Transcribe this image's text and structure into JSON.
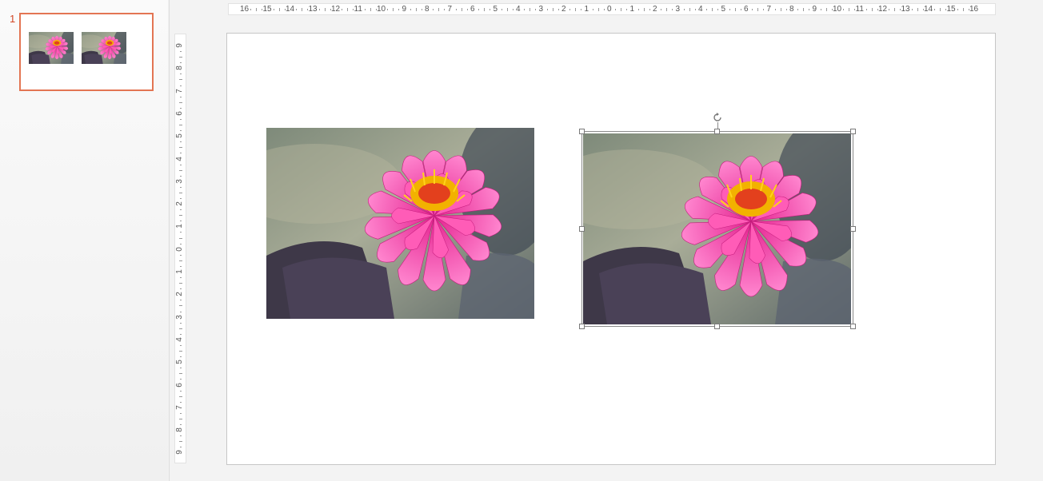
{
  "thumbnails": {
    "slide_number": "1"
  },
  "ruler": {
    "horizontal_labels": [
      "16",
      "15",
      "14",
      "13",
      "12",
      "11",
      "10",
      "9",
      "8",
      "7",
      "6",
      "5",
      "4",
      "3",
      "2",
      "1",
      "0",
      "1",
      "2",
      "3",
      "4",
      "5",
      "6",
      "7",
      "8",
      "9",
      "10",
      "11",
      "12",
      "13",
      "14",
      "15",
      "16"
    ],
    "vertical_labels": [
      "9",
      "8",
      "7",
      "6",
      "5",
      "4",
      "3",
      "2",
      "1",
      "0",
      "1",
      "2",
      "3",
      "4",
      "5",
      "6",
      "7",
      "8",
      "9"
    ]
  },
  "slide": {
    "images": [
      {
        "name": "water-lily-photo-1",
        "selected": false
      },
      {
        "name": "water-lily-photo-2",
        "selected": true
      }
    ]
  },
  "colors": {
    "accent": "#e37553",
    "slide_number": "#d24726",
    "petal": "#f03ba0",
    "petal_light": "#ff7ccb",
    "stamen": "#f5c400",
    "background_water": "#8c9688"
  }
}
